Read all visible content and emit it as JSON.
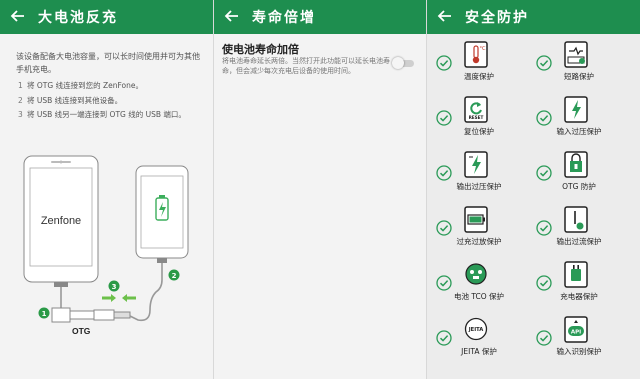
{
  "colors": {
    "accent": "#1e8e4f",
    "check": "#2a9a57",
    "background": "#f3f3f3"
  },
  "panel1": {
    "title": "大电池反充",
    "back_icon": "arrow-left-icon",
    "intro": "该设备配备大电池容量，可以长时间使用并可为其他手机充电。",
    "steps": [
      {
        "num": "1",
        "text": "将 OTG 线连接到您的 ZenFone。"
      },
      {
        "num": "2",
        "text": "将 USB 线连接到其他设备。"
      },
      {
        "num": "3",
        "text": "将 USB 线另一端连接到 OTG 线的 USB 端口。"
      }
    ],
    "illustration": {
      "brand": "Zenfone",
      "otg_label": "OTG",
      "callouts": [
        "1",
        "2",
        "3"
      ]
    }
  },
  "panel2": {
    "title": "寿命倍增",
    "back_icon": "arrow-left-icon",
    "setting_title": "使电池寿命加倍",
    "setting_desc": "将电池寿命延长两倍。当然打开此功能可以延长电池寿命，但会减少每次充电后设备的使用时间。",
    "toggle_on": false
  },
  "panel3": {
    "title": "安全防护",
    "back_icon": "arrow-left-icon",
    "features": [
      {
        "label": "温度保护",
        "icon": "thermometer-icon"
      },
      {
        "label": "短路保护",
        "icon": "short-circuit-icon"
      },
      {
        "label": "复位保护",
        "icon": "reset-icon",
        "icon_text": "RESET"
      },
      {
        "label": "输入过压保护",
        "icon": "input-overvoltage-icon"
      },
      {
        "label": "输出过压保护",
        "icon": "output-overvoltage-icon"
      },
      {
        "label": "OTG 防护",
        "icon": "otg-protection-icon"
      },
      {
        "label": "过充过放保护",
        "icon": "overcharge-battery-icon"
      },
      {
        "label": "输出过流保护",
        "icon": "output-overcurrent-icon"
      },
      {
        "label": "电池 TCO 保护",
        "icon": "tco-icon"
      },
      {
        "label": "充电器保护",
        "icon": "charger-protection-icon"
      },
      {
        "label": "JEITA 保护",
        "icon": "jeita-icon",
        "icon_text": "JEITA"
      },
      {
        "label": "输入识别保护",
        "icon": "api-icon",
        "icon_text": "API"
      }
    ]
  }
}
